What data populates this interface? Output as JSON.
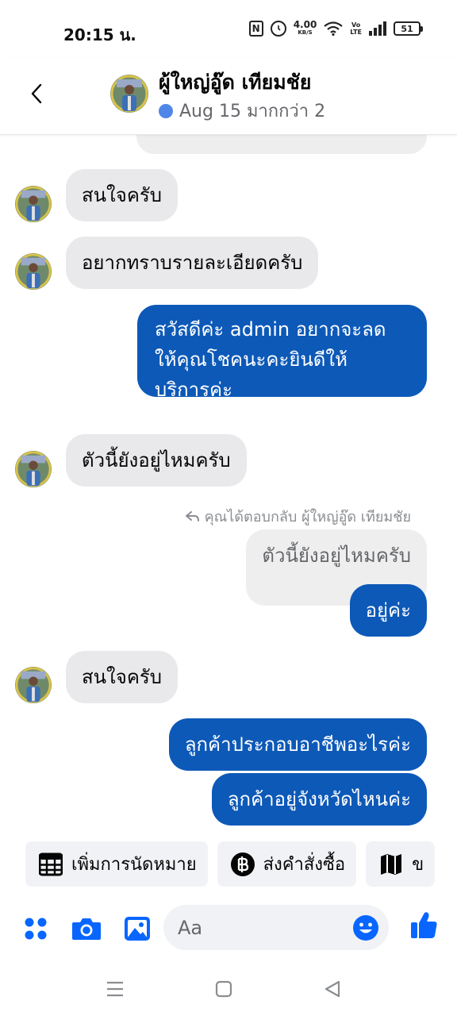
{
  "status_bar": {
    "time": "20:15 น.",
    "nfc": "N",
    "speed_value": "4.00",
    "speed_unit": "KB/S",
    "volte_top": "Vo",
    "volte_bottom": "LTE",
    "battery": "51"
  },
  "header": {
    "name": "ผู้ใหญ่อู๊ด เทียมชัย",
    "subtitle": "Aug 15 มากกว่า 2",
    "online_color": "#4f86e8"
  },
  "messages": [
    {
      "from": "them",
      "text": "สนใจครับ"
    },
    {
      "from": "them",
      "text": "อยากทราบรายละเอียดครับ"
    },
    {
      "from": "me",
      "lines": [
        "สวัสดีค่ะ admin อยากจะลด",
        "ให้คุณโชคนะคะยินดีให้",
        "บริการค่ะ"
      ]
    },
    {
      "from": "them",
      "text": "ตัวนี้ยังอยู่ไหมครับ"
    },
    {
      "from": "me",
      "reply_note": "คุณได้ตอบกลับ ผู้ใหญ่อู๊ด เทียมชัย",
      "quoted": "ตัวนี้ยังอยู่ไหมครับ",
      "text": "อยู่ค่ะ"
    },
    {
      "from": "them",
      "text": "สนใจครับ"
    },
    {
      "from": "me",
      "text": "ลูกค้าประกอบอาชีพอะไรค่ะ"
    },
    {
      "from": "me",
      "text": "ลูกค้าอยู่จังหวัดไหนค่ะ"
    }
  ],
  "quick_replies": [
    {
      "label": "เพิ่มการนัดหมาย",
      "icon": "calendar-icon"
    },
    {
      "label": "ส่งคำสั่งซื้อ",
      "icon": "baht-icon"
    },
    {
      "label": "ข",
      "icon": "map-icon"
    }
  ],
  "composer": {
    "placeholder": "Aa"
  },
  "colors": {
    "outgoing": "#0d59b8",
    "incoming": "#e9e9eb",
    "accent": "#0866ff"
  }
}
